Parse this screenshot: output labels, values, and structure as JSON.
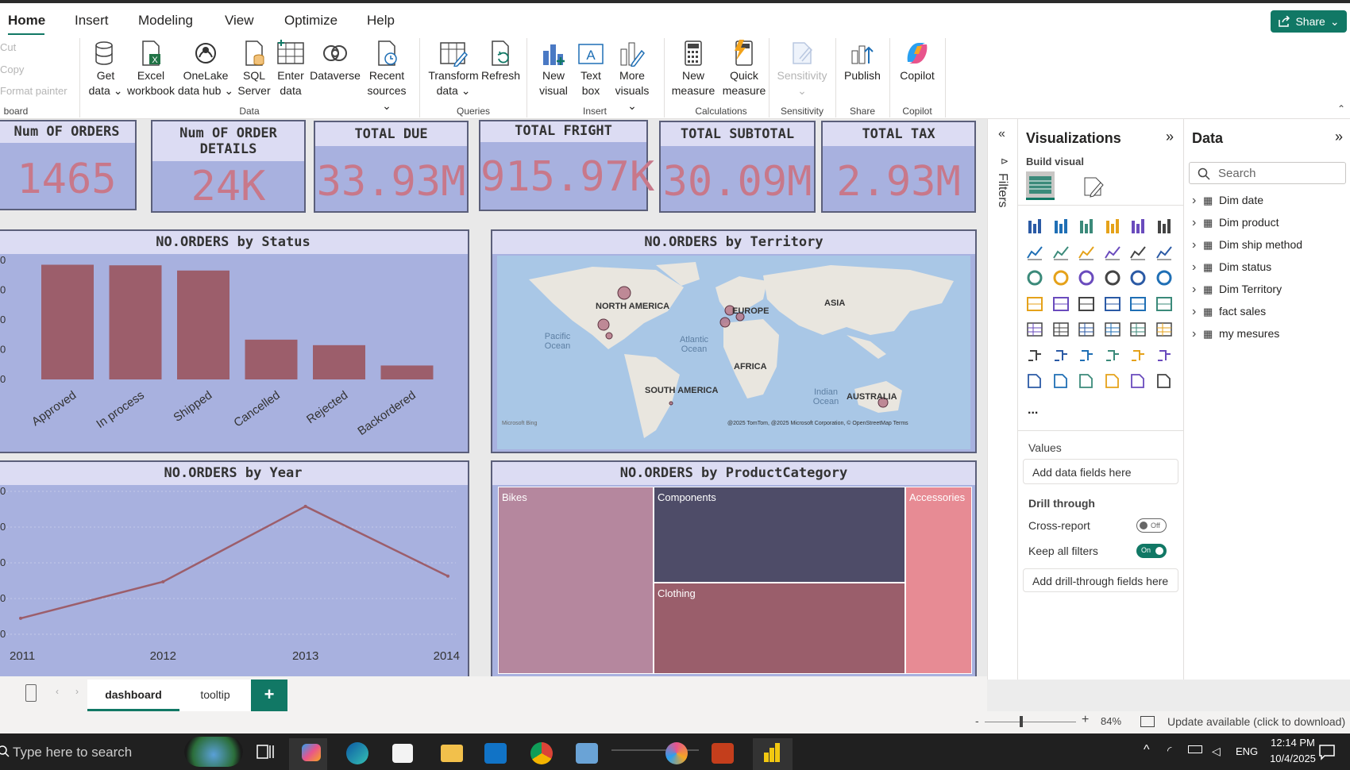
{
  "menu": {
    "tabs": [
      "Home",
      "Insert",
      "Modeling",
      "View",
      "Optimize",
      "Help"
    ],
    "share_label": "Share"
  },
  "ribbon": {
    "clipboard": [
      "Cut",
      "Copy",
      "Format painter"
    ],
    "clipboard_group": "board",
    "data_items": [
      {
        "l1": "Get",
        "l2": "data ⌄"
      },
      {
        "l1": "Excel",
        "l2": "workbook"
      },
      {
        "l1": "OneLake",
        "l2": "data hub ⌄"
      },
      {
        "l1": "SQL",
        "l2": "Server"
      },
      {
        "l1": "Enter",
        "l2": "data"
      },
      {
        "l1": "Dataverse",
        "l2": ""
      },
      {
        "l1": "Recent",
        "l2": "sources ⌄"
      }
    ],
    "data_group": "Data",
    "queries_items": [
      {
        "l1": "Transform",
        "l2": "data ⌄"
      },
      {
        "l1": "Refresh",
        "l2": ""
      }
    ],
    "queries_group": "Queries",
    "insert_items": [
      {
        "l1": "New",
        "l2": "visual"
      },
      {
        "l1": "Text",
        "l2": "box"
      },
      {
        "l1": "More",
        "l2": "visuals ⌄"
      }
    ],
    "insert_group": "Insert",
    "calc_items": [
      {
        "l1": "New",
        "l2": "measure"
      },
      {
        "l1": "Quick",
        "l2": "measure"
      }
    ],
    "calc_group": "Calculations",
    "sensitivity_label": "Sensitivity",
    "sensitivity_group": "Sensitivity",
    "publish_label": "Publish",
    "share_group": "Share",
    "copilot_label": "Copilot",
    "copilot_group": "Copilot"
  },
  "cards": [
    {
      "title": "Num OF ORDERS",
      "value": "1465"
    },
    {
      "title": "Num OF ORDER DETAILS",
      "value": "24K"
    },
    {
      "title": "TOTAL DUE",
      "value": "33.93M"
    },
    {
      "title": "TOTAL FRIGHT",
      "value": "915.97K"
    },
    {
      "title": "TOTAL SUBTOTAL",
      "value": "30.09M"
    },
    {
      "title": "TOTAL TAX",
      "value": "2.93M"
    }
  ],
  "status_chart": {
    "title": "NO.ORDERS by Status"
  },
  "territory_map": {
    "title": "NO.ORDERS by Territory",
    "labels": {
      "north_america": "NORTH AMERICA",
      "europe": "EUROPE",
      "asia": "ASIA",
      "africa": "AFRICA",
      "south_america": "SOUTH AMERICA",
      "australia": "AUSTRALIA",
      "pacific": "Pacific Ocean",
      "atlantic": "Atlantic Ocean",
      "indian": "Indian Ocean"
    },
    "attribution": "@2025 TomTom, @2025 Microsoft Corporation, © OpenStreetMap  Terms",
    "bing": "Microsoft Bing"
  },
  "year_chart": {
    "title": "NO.ORDERS by Year"
  },
  "category_treemap": {
    "title": "NO.ORDERS by ProductCategory",
    "tiles": [
      "Bikes",
      "Components",
      "Clothing",
      "Accessories"
    ]
  },
  "chart_data": [
    {
      "type": "bar",
      "title": "NO.ORDERS by Status",
      "categories": [
        "Approved",
        "In process",
        "Shipped",
        "Cancelled",
        "Rejected",
        "Backordered"
      ],
      "values": [
        395,
        393,
        375,
        137,
        118,
        48
      ],
      "ylim": [
        0,
        410
      ],
      "grid": false
    },
    {
      "type": "line",
      "title": "NO.ORDERS by Year",
      "x": [
        "2011",
        "2012",
        "2013",
        "2014"
      ],
      "values": [
        48,
        158,
        385,
        175
      ],
      "ylim": [
        0,
        430
      ],
      "grid": true
    }
  ],
  "visualizations": {
    "title": "Visualizations",
    "build_visual": "Build visual",
    "values_label": "Values",
    "add_data_fields": "Add data fields here",
    "drill_through": "Drill through",
    "cross_report": "Cross-report",
    "cross_report_state": "Off",
    "keep_all_filters": "Keep all filters",
    "keep_state": "On",
    "add_drill_fields": "Add drill-through fields here",
    "more": "...",
    "filters_label": "Filters"
  },
  "data_pane": {
    "title": "Data",
    "search_placeholder": "Search",
    "items": [
      "Dim date",
      "Dim product",
      "Dim ship method",
      "Dim status",
      "Dim Territory",
      "fact sales",
      "my mesures"
    ]
  },
  "page_tabs": {
    "tabs": [
      "dashboard",
      "tooltip"
    ],
    "add": "+"
  },
  "statusbar": {
    "zoom": "84%",
    "update": "Update available (click to download)"
  },
  "taskbar": {
    "search_placeholder": "Type here to search",
    "lang": "ENG",
    "time": "12:14 PM",
    "date": "10/4/2025"
  }
}
